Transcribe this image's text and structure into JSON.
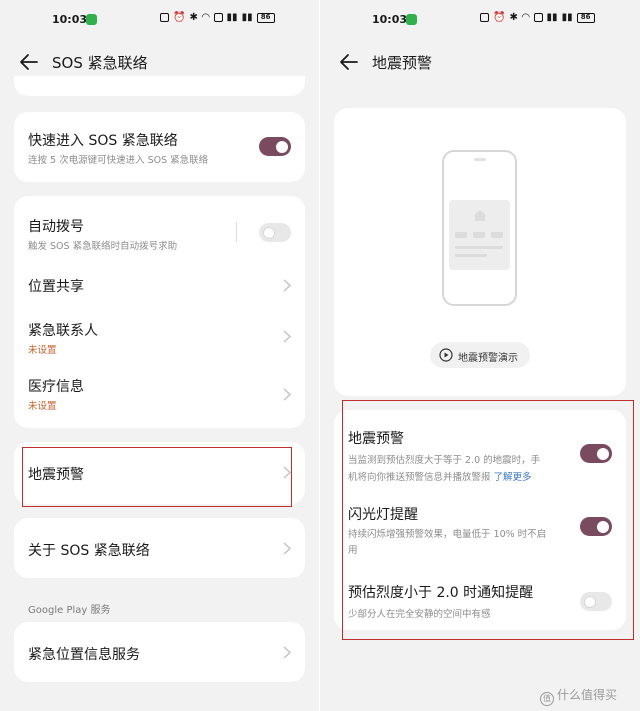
{
  "status_bar": {
    "time": "10:03",
    "battery": "86"
  },
  "left": {
    "nav_title": "SOS 紧急联络",
    "quick_sos": {
      "title": "快速进入 SOS 紧急联络",
      "subtitle": "连按 5 次电源键可快速进入 SOS 紧急联络",
      "toggle": "on"
    },
    "auto_dial": {
      "title": "自动拨号",
      "subtitle": "触发 SOS 紧急联络时自动拨号求助",
      "toggle": "off"
    },
    "location_share": {
      "title": "位置共享"
    },
    "emergency_contacts": {
      "title": "紧急联系人",
      "subtitle": "未设置"
    },
    "medical_info": {
      "title": "医疗信息",
      "subtitle": "未设置"
    },
    "earthquake_warning": {
      "title": "地震预警"
    },
    "about_sos": {
      "title": "关于 SOS 紧急联络"
    },
    "google_play_label": "Google Play 服务",
    "elocation_service": {
      "title": "紧急位置信息服务"
    }
  },
  "right": {
    "nav_title": "地震预警",
    "demo_button": "地震预警演示",
    "settings": [
      {
        "title": "地震预警",
        "subtitle_1": "当监测到预估烈度大于等于 2.0 的地震时，手",
        "subtitle_2": "机将向你推送预警信息并播放警报",
        "link": "了解更多",
        "toggle": "on"
      },
      {
        "title": "闪光灯提醒",
        "subtitle_1": "持续闪烁增强预警效果，电量低于 10% 时不启",
        "subtitle_2": "用",
        "toggle": "on"
      },
      {
        "title": "预估烈度小于 2.0 时通知提醒",
        "subtitle_1": "少部分人在完全安静的空间中有感",
        "toggle": "off"
      }
    ]
  },
  "watermark": "什么值得买",
  "colors": {
    "toggle_on": "#7a4a5f",
    "highlight": "#c0302a",
    "link": "#3a78c8",
    "orange_hint": "#c8632c"
  }
}
